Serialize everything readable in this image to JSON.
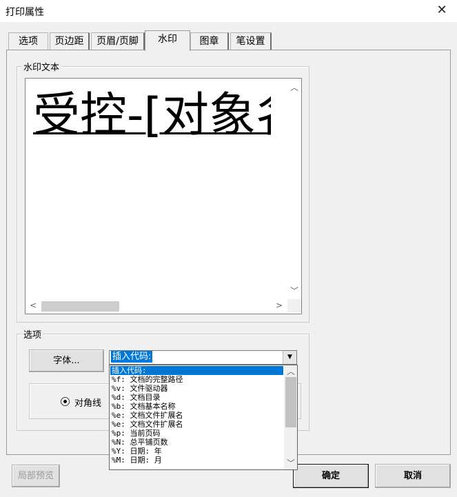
{
  "window": {
    "title": "打印属性"
  },
  "tabs": [
    {
      "label": "选项"
    },
    {
      "label": "页边距"
    },
    {
      "label": "页眉/页脚"
    },
    {
      "label": "水印",
      "active": true
    },
    {
      "label": "图章"
    },
    {
      "label": "笔设置"
    }
  ],
  "watermark": {
    "group_label": "水印文本",
    "text": "受控-[对象名称]"
  },
  "options": {
    "group_label": "选项",
    "font_button": "字体...",
    "insert_code_value": "插入代码:",
    "codes": [
      "插入代码:",
      "%f: 文档的完整路径",
      "%v: 文件驱动器",
      "%d: 文档目录",
      "%b: 文档基本名称",
      "%e: 文档文件扩展名",
      "%e: 文档文件扩展名",
      "%p: 当前页码",
      "%N: 总平铺页数",
      "%Y: 日期: 年",
      "%M: 日期: 月"
    ],
    "diagonal_label": "对角线"
  },
  "footer": {
    "preview_button": "局部预览",
    "ok_button": "确定",
    "cancel_button": "取消"
  },
  "colors": {
    "selection": "#0078d7",
    "background": "#f0f0f0"
  }
}
